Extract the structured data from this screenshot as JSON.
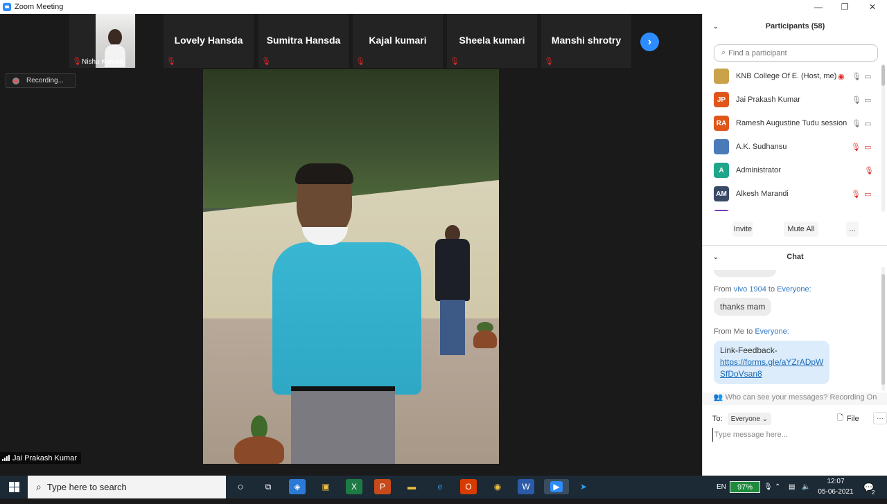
{
  "window": {
    "title": "Zoom Meeting",
    "minimize": "—",
    "maximize": "❐",
    "close": "✕"
  },
  "strip": {
    "tiles": [
      {
        "name": "Nishu Kumari"
      },
      {
        "name": "Lovely Hansda"
      },
      {
        "name": "Sumitra Hansda"
      },
      {
        "name": "Kajal kumari"
      },
      {
        "name": "Sheela kumari"
      },
      {
        "name": "Manshi shrotry"
      }
    ],
    "next_icon": "›"
  },
  "recording": {
    "label": "Recording..."
  },
  "main_video": {
    "speaker": "Jai Prakash Kumar"
  },
  "participants": {
    "header": "Participants (58)",
    "search_placeholder": "Find a participant",
    "list": [
      {
        "initials": "",
        "name": "KNB College Of E...",
        "role": "(Host, me)",
        "color": "#c9a24a",
        "mic": "on",
        "video": "on",
        "recording": true
      },
      {
        "initials": "JP",
        "name": "Jai Prakash Kumar",
        "role": "",
        "color": "#e0561a",
        "mic": "on",
        "video": "on",
        "recording": false
      },
      {
        "initials": "RA",
        "name": "Ramesh Augustine Tudu session ...",
        "role": "",
        "color": "#e0561a",
        "mic": "on",
        "video": "on",
        "recording": false
      },
      {
        "initials": "",
        "name": "A.K. Sudhansu",
        "role": "",
        "color": "#4a7ab8",
        "mic": "muted",
        "video": "off",
        "recording": false
      },
      {
        "initials": "A",
        "name": "Administrator",
        "role": "",
        "color": "#1ea58a",
        "mic": "muted",
        "video": "none",
        "recording": false
      },
      {
        "initials": "AM",
        "name": "Alkesh Marandi",
        "role": "",
        "color": "#3a4a66",
        "mic": "muted",
        "video": "off",
        "recording": false
      }
    ],
    "invite": "Invite",
    "mute_all": "Mute All",
    "more": "..."
  },
  "chat": {
    "header": "Chat",
    "messages": [
      {
        "from_prefix": "From",
        "from": "vivo 1904",
        "to_word": "to",
        "to": "Everyone:",
        "text": "thanks mam"
      },
      {
        "from_prefix": "From Me",
        "from": "",
        "to_word": "to",
        "to": "Everyone:",
        "text_label": "Link-Feedback-",
        "link": "https://forms.gle/aYZrADpWSfDoVsan8",
        "link_line1": "https://forms.gle/aYZrADpW",
        "link_line2": "SfDoVsan8"
      }
    ],
    "who_can_see": "Who can see your messages? Recording On",
    "to_label": "To:",
    "to_value": "Everyone",
    "file_label": "File",
    "more": "···",
    "placeholder": "Type message here..."
  },
  "taskbar": {
    "search_text": "Type here to search",
    "lang": "EN",
    "battery": "97%",
    "time": "12:07",
    "date": "05-06-2021",
    "notification_count": "2"
  }
}
